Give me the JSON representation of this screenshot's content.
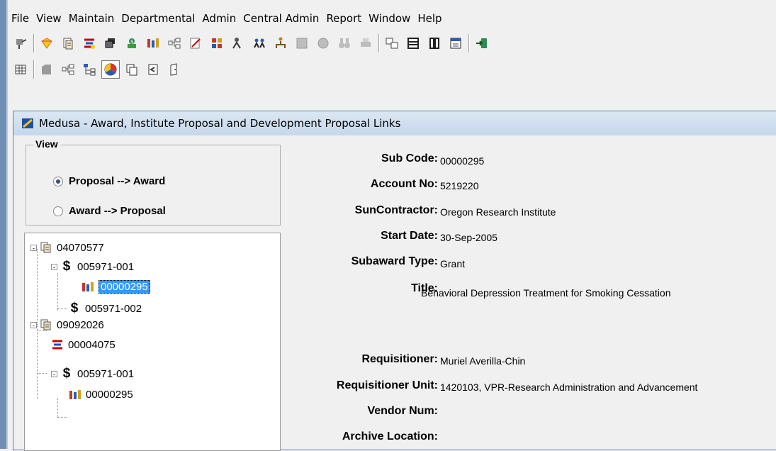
{
  "menu": {
    "items": [
      {
        "label": "File"
      },
      {
        "label": "View"
      },
      {
        "label": "Maintain"
      },
      {
        "label": "Departmental"
      },
      {
        "label": "Admin"
      },
      {
        "label": "Central Admin"
      },
      {
        "label": "Report"
      },
      {
        "label": "Window"
      },
      {
        "label": "Help"
      }
    ]
  },
  "toolbar": {
    "row1_icons": [
      "pin-icon",
      "award-icon",
      "proposal-icon",
      "subcontract-icon",
      "negotiation-icon",
      "money-icon",
      "subaward-icon",
      "tree-icon",
      "sign-icon",
      "grid-icon",
      "people-icon",
      "group-icon",
      "org-icon",
      "disabled-icon",
      "disabled-icon",
      "binoculars-icon",
      "printer-icon",
      "merge-icon",
      "list-icon",
      "columns-icon",
      "calendar-icon",
      "exit-icon"
    ],
    "row2_icons": [
      "grid-icon",
      "tab-icon",
      "tree-icon",
      "hierarchy-icon",
      "color-wheel-icon",
      "copy-icon",
      "book-icon",
      "door-icon"
    ]
  },
  "window": {
    "title": "Medusa - Award, Institute Proposal and Development Proposal Links"
  },
  "view": {
    "legend": "View",
    "options": [
      {
        "label": "Proposal --> Award",
        "checked": true
      },
      {
        "label": "Award --> Proposal",
        "checked": false
      }
    ]
  },
  "tree": {
    "nodes": [
      {
        "label": "04070577",
        "icon": "proposal-icon",
        "expander": "-"
      },
      {
        "label": "005971-001",
        "icon": "dollar-icon",
        "expander": "-"
      },
      {
        "label": "00000295",
        "icon": "subaward-icon",
        "selected": true
      },
      {
        "label": "005971-002",
        "icon": "dollar-icon"
      },
      {
        "label": "09092026",
        "icon": "proposal-icon",
        "expander": "-"
      },
      {
        "label": "00004075",
        "icon": "subcontract-icon"
      },
      {
        "label": "005971-001",
        "icon": "dollar-icon",
        "expander": "-"
      },
      {
        "label": "00000295",
        "icon": "subaward-icon"
      }
    ]
  },
  "details": {
    "sub_code_label": "Sub Code:",
    "sub_code": "00000295",
    "account_label": "Account No:",
    "account": "5219220",
    "contractor_label": "SunContractor:",
    "contractor": "Oregon Research Institute",
    "start_label": "Start Date:",
    "start": "30-Sep-2005",
    "type_label": "Subaward Type:",
    "type": "Grant",
    "title_label": "Title:",
    "title": "Behavioral Depression Treatment for Smoking Cessation",
    "req_label": "Requisitioner:",
    "req": "Muriel Averilla-Chin",
    "unit_label": "Requisitioner Unit:",
    "unit": "1420103, VPR-Research Administration and Advancement",
    "vendor_label": "Vendor Num:",
    "vendor": "",
    "archive_label": "Archive Location:",
    "archive": ""
  }
}
